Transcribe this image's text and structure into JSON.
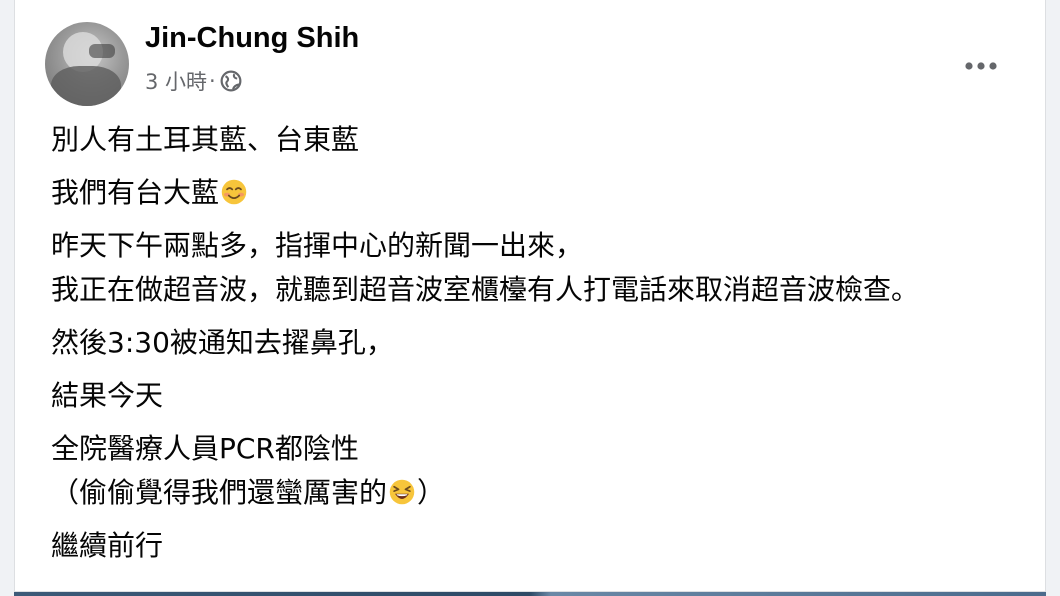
{
  "post": {
    "author": "Jin-Chung Shih",
    "time": "3 小時",
    "separator": "·",
    "privacy_icon": "globe-icon",
    "more_icon": "more-horizontal-icon",
    "paragraphs": [
      {
        "lines": [
          {
            "text": "別人有土耳其藍、台東藍"
          }
        ]
      },
      {
        "lines": [
          {
            "text": "我們有台大藍",
            "emoji": "smiling-face-emoji"
          }
        ]
      },
      {
        "lines": [
          {
            "text": "昨天下午兩點多，指揮中心的新聞一出來，"
          },
          {
            "text": "我正在做超音波，就聽到超音波室櫃檯有人打電話來取消超音波檢查。"
          }
        ]
      },
      {
        "lines": [
          {
            "text": "然後3:30被通知去擢鼻孔，"
          }
        ]
      },
      {
        "lines": [
          {
            "text": "結果今天"
          }
        ]
      },
      {
        "lines": [
          {
            "text": "全院醫療人員PCR都陰性"
          },
          {
            "text": "（偷偷覺得我們還蠻厲害的",
            "emoji": "grinning-squinting-face-emoji",
            "after": "）"
          }
        ]
      },
      {
        "lines": [
          {
            "text": "繼續前行"
          }
        ]
      }
    ]
  },
  "colors": {
    "text_primary": "#050505",
    "text_secondary": "#65676b",
    "card_bg": "#ffffff",
    "page_bg": "#f0f2f5"
  }
}
